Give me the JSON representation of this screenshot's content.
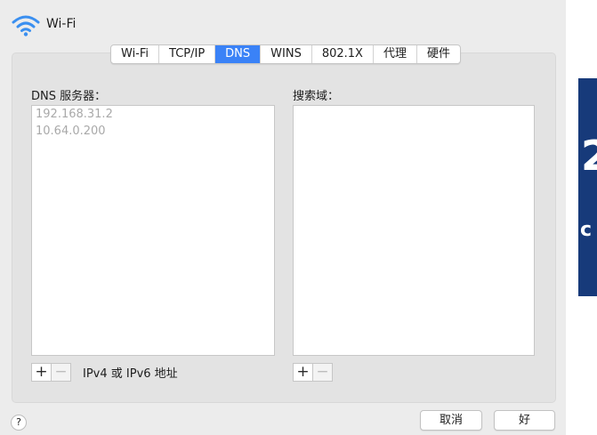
{
  "window": {
    "title": "Wi-Fi"
  },
  "tabs": [
    {
      "label": "Wi-Fi"
    },
    {
      "label": "TCP/IP"
    },
    {
      "label": "DNS"
    },
    {
      "label": "WINS"
    },
    {
      "label": "802.1X"
    },
    {
      "label": "代理"
    },
    {
      "label": "硬件"
    }
  ],
  "active_tab": "DNS",
  "dns": {
    "servers_label": "DNS 服务器：",
    "servers": [
      "192.168.31.2",
      "10.64.0.200"
    ],
    "add_label": "+",
    "remove_label": "−",
    "hint": "IPv4 或 IPv6 地址"
  },
  "search": {
    "label": "搜索域：",
    "domains": [],
    "add_label": "+",
    "remove_label": "−"
  },
  "footer": {
    "help": "?",
    "cancel": "取消",
    "ok": "好"
  },
  "colors": {
    "accent": "#3a82f7",
    "placeholder_text": "#a9a9a9",
    "background": "#ececec"
  }
}
